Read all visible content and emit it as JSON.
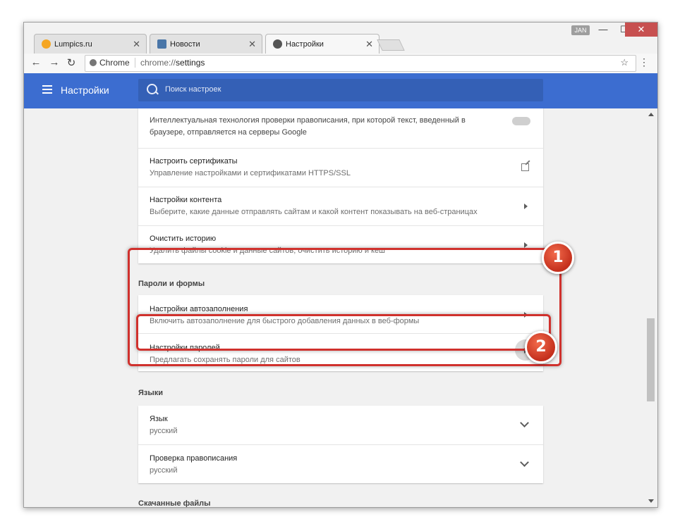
{
  "tabs": [
    {
      "label": "Lumpics.ru",
      "favicon_color": "#f5a623"
    },
    {
      "label": "Новости",
      "favicon_color": "#4a76a8"
    },
    {
      "label": "Настройки",
      "favicon_color": "#555555"
    }
  ],
  "tab_close_glyph": "✕",
  "window_controls": {
    "user": "JAN",
    "minimize": "—",
    "maximize": "☐",
    "close": "✕"
  },
  "toolbar": {
    "back": "←",
    "forward": "→",
    "reload": "↻",
    "site_chip": "Chrome",
    "url_scheme": "chrome://",
    "url_path": "settings",
    "star": "☆",
    "menu": "⋮"
  },
  "header": {
    "title": "Настройки",
    "search_placeholder": "Поиск настроек"
  },
  "privacy_rows": [
    {
      "title": "Интеллектуальная технология проверки правописания, при которой текст, введенный в",
      "subtitle": "браузере, отправляется на серверы Google"
    },
    {
      "title": "Настроить сертификаты",
      "subtitle": "Управление настройками и сертификатами HTTPS/SSL"
    },
    {
      "title": "Настройки контента",
      "subtitle": "Выберите, какие данные отправлять сайтам и какой контент показывать на веб-страницах"
    },
    {
      "title": "Очистить историю",
      "subtitle": "Удалить файлы cookie и данные сайтов, очистить историю и кеш"
    }
  ],
  "passwords_section": {
    "heading": "Пароли и формы",
    "rows": [
      {
        "title": "Настройки автозаполнения",
        "subtitle": "Включить автозаполнение для быстрого добавления данных в веб-формы"
      },
      {
        "title": "Настройки паролей",
        "subtitle": "Предлагать сохранять пароли для сайтов"
      }
    ]
  },
  "languages_section": {
    "heading": "Языки",
    "rows": [
      {
        "title": "Язык",
        "subtitle": "русский"
      },
      {
        "title": "Проверка правописания",
        "subtitle": "русский"
      }
    ]
  },
  "downloads_section": {
    "heading": "Скачанные файлы"
  },
  "annotations": {
    "badge1": "1",
    "badge2": "2",
    "color": "#d0312d"
  }
}
